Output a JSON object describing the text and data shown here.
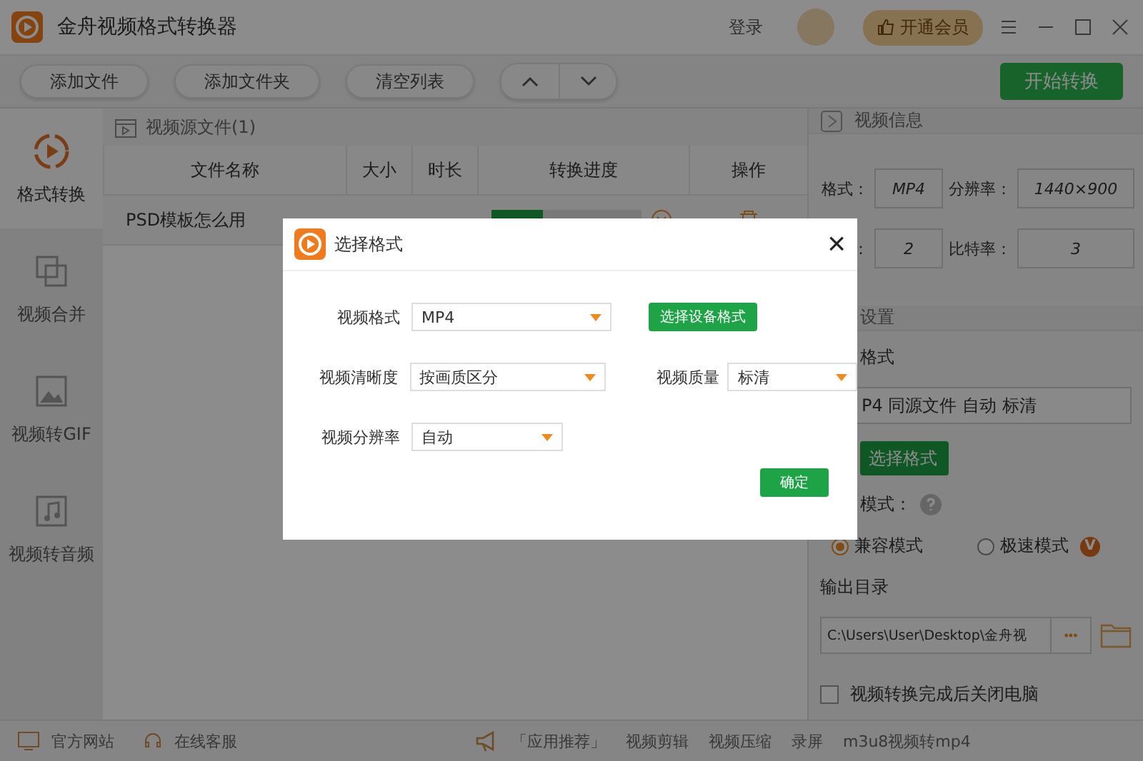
{
  "window": {
    "title": "金舟视频格式转换器",
    "login": "登录",
    "vip_button": "开通会员"
  },
  "toolbar": {
    "buttons": [
      "添加文件",
      "添加文件夹",
      "清空列表"
    ],
    "start_button": "开始转换"
  },
  "sidebar": {
    "items": [
      {
        "label": "格式转换",
        "selected": true
      },
      {
        "label": "视频合并",
        "selected": false
      },
      {
        "label": "视频转GIF",
        "selected": false
      },
      {
        "label": "视频转音频",
        "selected": false
      }
    ]
  },
  "file_list": {
    "title": "视频源文件(1)",
    "columns": [
      "文件名称",
      "大小",
      "时长",
      "转换进度",
      "操作"
    ],
    "rows": [
      {
        "name": "PSD模板怎么用",
        "level": 0.34
      }
    ]
  },
  "video_info": {
    "title": "视频信息",
    "fields": [
      {
        "label": "格式：",
        "value": "MP4"
      },
      {
        "label": "分辨率：",
        "value": "1440×900"
      },
      {
        "label": "：",
        "value": "2"
      },
      {
        "label": "比特率：",
        "value": "3"
      }
    ]
  },
  "settings": {
    "title": "设置",
    "format_label": "格式",
    "format_value": "P4 同源文件 自动 标清",
    "format_button": "选择格式",
    "mode_label": "模式：",
    "modes": [
      {
        "label": "兼容模式",
        "selected": true,
        "vip": false
      },
      {
        "label": "极速模式",
        "selected": false,
        "vip": true
      }
    ],
    "vip_badge": "V",
    "output_label": "输出目录",
    "output_path": "C:\\Users\\User\\Desktop\\金舟视",
    "browse": "•••",
    "shutdown": {
      "label": "视频转换完成后关闭电脑",
      "checked": false
    }
  },
  "status_bar": {
    "links": [
      "官方网站",
      "在线客服"
    ],
    "recommend": "「应用推荐」",
    "apps": [
      "视频剪辑",
      "视频压缩",
      "录屏",
      "m3u8视频转mp4"
    ]
  },
  "dialog": {
    "title": "选择格式",
    "close": "×",
    "rows": [
      [
        {
          "kind": "select",
          "label": "视频格式",
          "value": "MP4"
        },
        {
          "kind": "button",
          "label": "选择设备格式"
        }
      ],
      [
        {
          "kind": "select",
          "label": "视频清晰度",
          "value": "按画质区分"
        },
        {
          "kind": "select",
          "label": "视频质量",
          "value": "标清"
        }
      ],
      [
        {
          "kind": "select",
          "label": "视频分辨率",
          "value": "自动"
        }
      ]
    ],
    "ok": "确定"
  }
}
